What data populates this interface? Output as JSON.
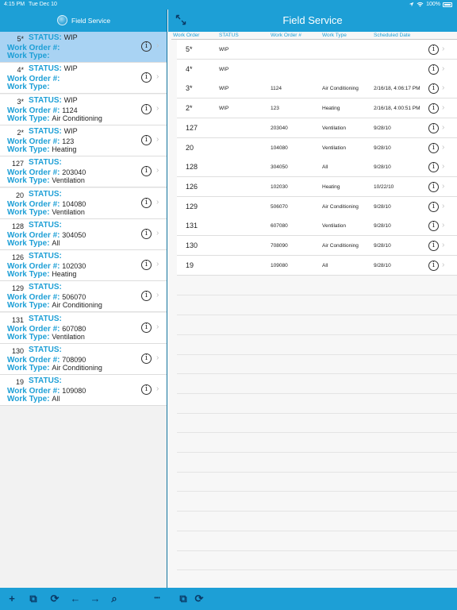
{
  "status_bar": {
    "time": "4:15 PM",
    "date": "Tue Dec 10",
    "wifi_icon": "wifi-icon",
    "signal_icon": "location-arrow-icon",
    "battery": "100%"
  },
  "left_header": {
    "title": "Field Service",
    "logo_icon": "globe-logo-icon"
  },
  "right_header": {
    "title": "Field Service",
    "expand_icon": "expand-arrows-icon"
  },
  "labels": {
    "status": "STATUS:",
    "work_order": "Work Order #:",
    "work_type": "Work Type:"
  },
  "left_list": [
    {
      "num": "5*",
      "status": "WIP",
      "work_order": "",
      "work_type": "",
      "selected": true
    },
    {
      "num": "4*",
      "status": "WIP",
      "work_order": "",
      "work_type": ""
    },
    {
      "num": "3*",
      "status": "WIP",
      "work_order": "1124",
      "work_type": "Air Conditioning"
    },
    {
      "num": "2*",
      "status": "WIP",
      "work_order": "123",
      "work_type": "Heating"
    },
    {
      "num": "127",
      "status": "",
      "work_order": "203040",
      "work_type": "Ventilation"
    },
    {
      "num": "20",
      "status": "",
      "work_order": "104080",
      "work_type": "Ventilation"
    },
    {
      "num": "128",
      "status": "",
      "work_order": "304050",
      "work_type": "All"
    },
    {
      "num": "126",
      "status": "",
      "work_order": "102030",
      "work_type": "Heating"
    },
    {
      "num": "129",
      "status": "",
      "work_order": "506070",
      "work_type": "Air Conditioning"
    },
    {
      "num": "131",
      "status": "",
      "work_order": "607080",
      "work_type": "Ventilation"
    },
    {
      "num": "130",
      "status": "",
      "work_order": "708090",
      "work_type": "Air Conditioning"
    },
    {
      "num": "19",
      "status": "",
      "work_order": "109080",
      "work_type": "All"
    }
  ],
  "grid": {
    "columns": [
      "Work Order",
      "STATUS",
      "Work Order #",
      "Work Type",
      "Scheduled Date"
    ],
    "rows": [
      [
        "5*",
        "WIP",
        "",
        "",
        ""
      ],
      [
        "4*",
        "WIP",
        "",
        "",
        ""
      ],
      [
        "3*",
        "WIP",
        "1124",
        "Air Conditioning",
        "2/16/18, 4:06:17 PM"
      ],
      [
        "2*",
        "WIP",
        "123",
        "Heating",
        "2/16/18, 4:00:51 PM"
      ],
      [
        "127",
        "",
        "203040",
        "Ventilation",
        "9/28/10"
      ],
      [
        "20",
        "",
        "104080",
        "Ventilation",
        "9/28/10"
      ],
      [
        "128",
        "",
        "304050",
        "All",
        "9/28/10"
      ],
      [
        "126",
        "",
        "102030",
        "Heating",
        "10/22/10"
      ],
      [
        "129",
        "",
        "506070",
        "Air Conditioning",
        "9/28/10"
      ],
      [
        "131",
        "",
        "607080",
        "Ventilation",
        "9/28/10"
      ],
      [
        "130",
        "",
        "708090",
        "Air Conditioning",
        "9/28/10"
      ],
      [
        "19",
        "",
        "109080",
        "All",
        "9/28/10"
      ]
    ]
  },
  "icons": {
    "info": "i",
    "chevron": "›",
    "info_icon_name": "info-circle-icon",
    "chevron_icon_name": "chevron-right-icon"
  },
  "toolbar": {
    "items": [
      {
        "name": "add-icon",
        "glyph": "+"
      },
      {
        "name": "copy-icon",
        "glyph": "⧉"
      },
      {
        "name": "sync-icon",
        "glyph": "⟳"
      },
      {
        "name": "back-arrow-icon",
        "glyph": "←"
      },
      {
        "name": "forward-arrow-icon",
        "glyph": "→"
      },
      {
        "name": "search-icon",
        "glyph": "⌕"
      },
      {
        "name": "more-icon",
        "glyph": "•••"
      },
      {
        "name": "copy-icon-right",
        "glyph": "⧉"
      },
      {
        "name": "sync-icon-right",
        "glyph": "⟳"
      }
    ]
  },
  "colors": {
    "accent": "#1d9fd6",
    "selected_row": "#a9d3f3",
    "toolbar_icon": "#0a3a66"
  }
}
